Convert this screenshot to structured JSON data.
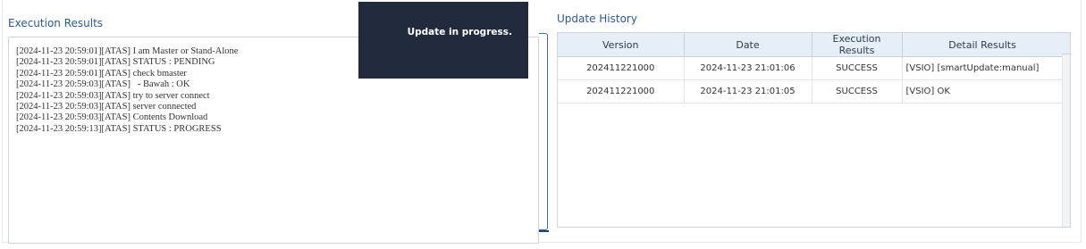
{
  "execution_results": {
    "title": "Execution Results",
    "log_lines": [
      "[2024-11-23 20:59:01][ATAS] I am Master or Stand-Alone",
      "[2024-11-23 20:59:01][ATAS] STATUS : PENDING",
      "[2024-11-23 20:59:01][ATAS] check bmaster",
      "[2024-11-23 20:59:03][ATAS]   - Bawah : OK",
      "[2024-11-23 20:59:03][ATAS] try to server connect",
      "[2024-11-23 20:59:03][ATAS] server connected",
      "[2024-11-23 20:59:03][ATAS] Contents Download",
      "[2024-11-23 20:59:13][ATAS] STATUS : PROGRESS"
    ]
  },
  "toast": {
    "message": "Update in progress."
  },
  "update_history": {
    "title": "Update History",
    "columns": [
      "Version",
      "Date",
      "Execution Results",
      "Detail Results"
    ],
    "rows": [
      [
        "202411221000",
        "2024-11-23 21:01:06",
        "SUCCESS",
        "[VSIO] [smartUpdate:manual]"
      ],
      [
        "202411221000",
        "2024-11-23 21:01:05",
        "SUCCESS",
        "[VSIO] OK"
      ]
    ]
  },
  "colors": {
    "title_text": "#2a5a9a",
    "toast_bg": "#222a3d",
    "table_header_bg": "#e6eef8",
    "bracket": "#3a6fb0"
  }
}
